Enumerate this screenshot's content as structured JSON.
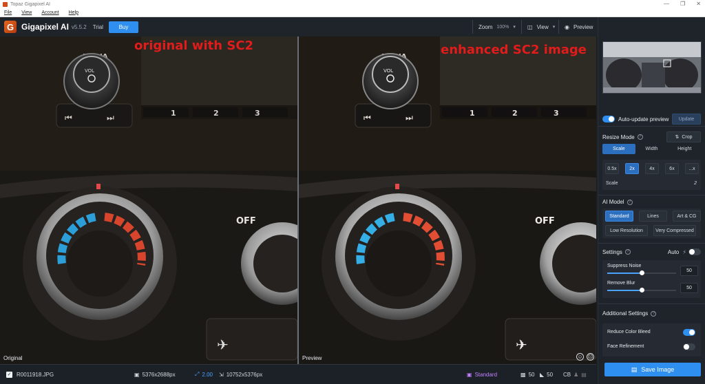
{
  "window": {
    "title": "Topaz Gigapixel AI"
  },
  "menu": [
    "File",
    "View",
    "Account",
    "Help"
  ],
  "toolbar": {
    "app_name": "Gigapixel AI",
    "version": "v5.5.2",
    "trial": "Trial",
    "buy_label": "Buy",
    "zoom_label": "Zoom",
    "zoom_value": "100%",
    "view_label": "View",
    "preview_label": "Preview"
  },
  "viewer": {
    "left_overlay": "original with SC2",
    "right_overlay": "enhanced SC2 image",
    "left_tag": "Original",
    "right_tag": "Preview",
    "dash_text": "MEDIA",
    "knob_text": "VOL",
    "presets": [
      "1",
      "2",
      "3"
    ],
    "off_text": "OFF"
  },
  "status": {
    "filename": "R0011918.JPG",
    "input_size": "5376x2688px",
    "scale": "2.00",
    "output_size": "10752x5376px",
    "model": "Standard",
    "noise": "50",
    "blur": "50",
    "cb": "CB"
  },
  "panel": {
    "auto_update_label": "Auto-update preview",
    "update_label": "Update",
    "resize_mode_label": "Resize Mode",
    "crop_label": "Crop",
    "resize_tabs": [
      "Scale",
      "Width",
      "Height"
    ],
    "scale_options": [
      "0.5x",
      "2x",
      "4x",
      "6x",
      "...x"
    ],
    "scale_label": "Scale",
    "scale_value": "2",
    "ai_model_label": "AI Model",
    "models_row1": [
      "Standard",
      "Lines",
      "Art & CG"
    ],
    "models_row2": [
      "Low Resolution",
      "Very Compressed"
    ],
    "settings_label": "Settings",
    "auto_label": "Auto",
    "suppress_noise_label": "Suppress Noise",
    "suppress_noise_value": "50",
    "remove_blur_label": "Remove Blur",
    "remove_blur_value": "50",
    "suppress_noise_level": 0.5,
    "remove_blur_level": 0.5,
    "additional_label": "Additional Settings",
    "reduce_color_bleed_label": "Reduce Color Bleed",
    "face_refinement_label": "Face Refinement",
    "save_label": "Save Image"
  },
  "colors": {
    "accent": "#2f8ff0",
    "overlay_text": "#e21b1b"
  }
}
